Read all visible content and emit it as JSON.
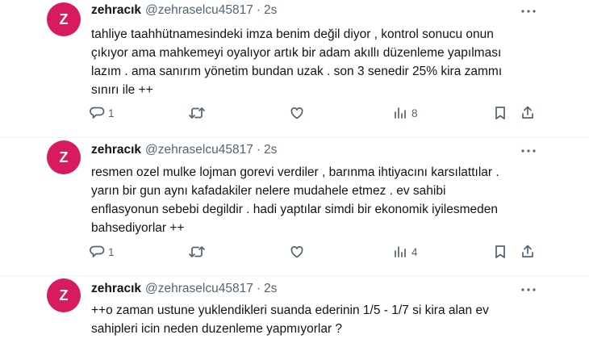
{
  "tweets": [
    {
      "avatar_initial": "Z",
      "display_name": "zehracık",
      "handle": "@zehraselcu45817",
      "separator": "·",
      "time": "2s",
      "text": "tahliye taahhütnamesindeki imza benim değil diyor , kontrol sonucu onun\nçıkıyor ama mahkemeyi oyalıyor  artık bir adam akıllı düzenleme yapılması\nlazım . ama sanırım yönetim bundan uzak . son 3 senedir 25% kira zammı\nsınırı ile ++",
      "reply_count": "1",
      "retweet_count": "",
      "like_count": "",
      "views_count": "8"
    },
    {
      "avatar_initial": "Z",
      "display_name": "zehracık",
      "handle": "@zehraselcu45817",
      "separator": "·",
      "time": "2s",
      "text": "resmen ozel mulke lojman gorevi verdiler , barınma ihtiyacını karsılattılar .\nyarın bir gun aynı kafadakiler nelere mudahele etmez . ev sahibi\nenflasyonun sebebi degildir . hadi yaptılar simdi bir ekonomik iyilesmeden\nbahsediyorlar ++",
      "reply_count": "1",
      "retweet_count": "",
      "like_count": "",
      "views_count": "4"
    },
    {
      "avatar_initial": "Z",
      "display_name": "zehracık",
      "handle": "@zehraselcu45817",
      "separator": "·",
      "time": "2s",
      "text": "++o zaman ustune yuklendikleri suanda ederinin 1/5 - 1/7 si kira alan ev\nsahipleri icin neden duzenleme yapmıyorlar ?",
      "reply_count": "",
      "retweet_count": "",
      "like_count": "",
      "views_count": ""
    }
  ],
  "icons": {
    "more": "more-horizontal-icon",
    "reply": "reply-icon",
    "retweet": "retweet-icon",
    "like": "heart-icon",
    "views": "views-icon",
    "bookmark": "bookmark-icon",
    "share": "share-icon"
  },
  "colors": {
    "avatar_bg": "#d81b60",
    "text": "#0f1419",
    "secondary": "#536471",
    "divider": "#eff3f4"
  }
}
